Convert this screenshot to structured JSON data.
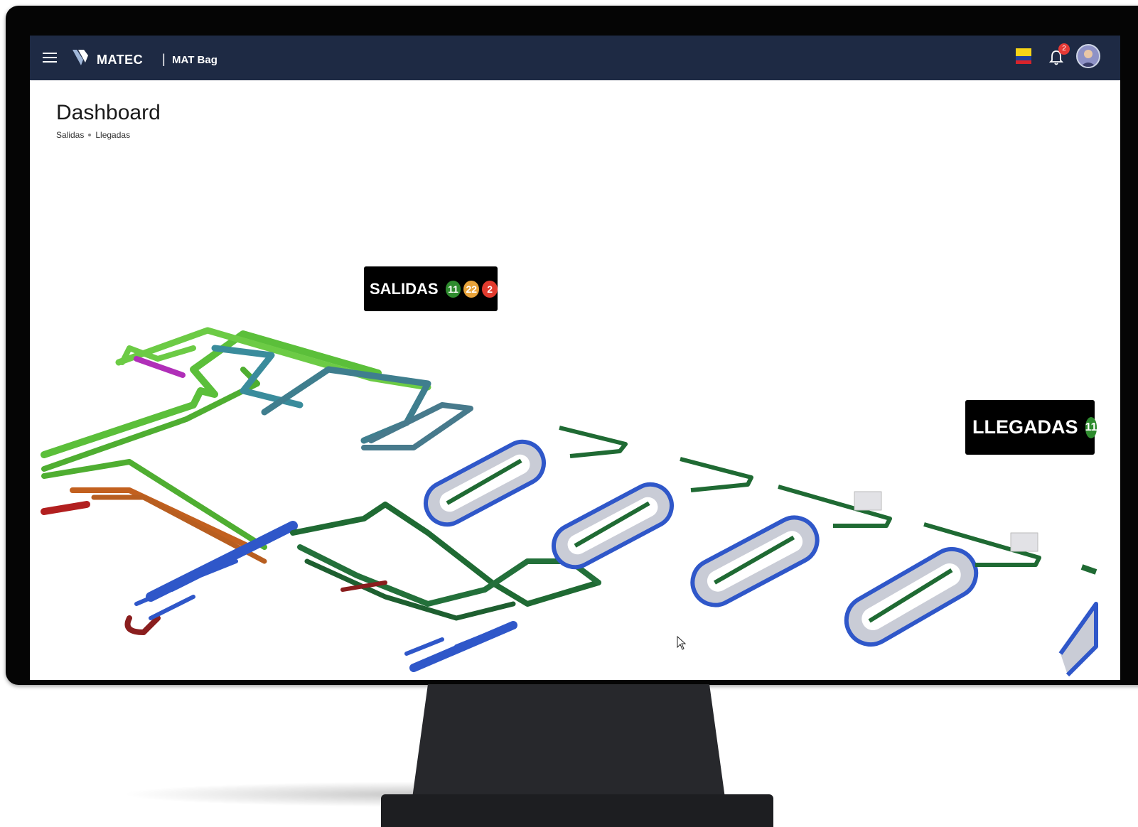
{
  "app": {
    "brand": "MATEC",
    "separator": "|",
    "product": "MAT Bag",
    "notifications_count": "2"
  },
  "page": {
    "title": "Dashboard",
    "breadcrumb": [
      "Salidas",
      "Llegadas"
    ]
  },
  "zones": {
    "salidas": {
      "label": "SALIDAS",
      "counts": [
        "11",
        "22",
        "2"
      ],
      "count_colors": [
        "#2e8b2e",
        "#e8a33a",
        "#e23b2e"
      ]
    },
    "llegadas": {
      "label": "LLEGADAS",
      "counts": [
        "11"
      ],
      "count_colors": [
        "#2e8b2e"
      ]
    }
  },
  "icons": {
    "menu": "hamburger-menu-icon",
    "notifications": "bell-icon",
    "language": "colombia-flag-icon",
    "profile": "user-avatar-icon"
  },
  "colors": {
    "topbar": "#1e2a44",
    "flag": [
      "#f7d417",
      "#1f3f99",
      "#d8232a"
    ]
  }
}
